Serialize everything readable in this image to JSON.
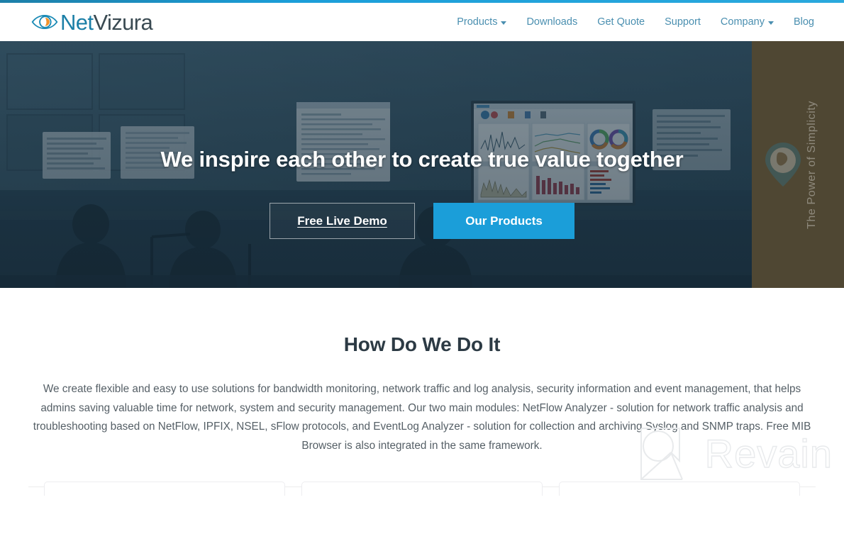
{
  "brand": {
    "name_part1": "Net",
    "name_part2": "Vizura",
    "logo_icon": "eye-icon",
    "accent_blue": "#1b9ed9",
    "logo_teal": "#1b7fa7",
    "logo_orange": "#f0922b"
  },
  "nav": {
    "items": [
      {
        "label": "Products",
        "has_dropdown": true
      },
      {
        "label": "Downloads",
        "has_dropdown": false
      },
      {
        "label": "Get Quote",
        "has_dropdown": false
      },
      {
        "label": "Support",
        "has_dropdown": false
      },
      {
        "label": "Company",
        "has_dropdown": true
      },
      {
        "label": "Blog",
        "has_dropdown": false
      }
    ]
  },
  "hero": {
    "title": "We inspire each other to create true value together",
    "primary_button": "Our Products",
    "secondary_button": "Free Live Demo",
    "side_panel_text": "The Power of Simplicity",
    "side_panel_color": "#4f4733",
    "side_panel_icon": "map-pin-globe-icon"
  },
  "main": {
    "section_title": "How Do We Do It",
    "section_body": "We create flexible and easy to use solutions for bandwidth monitoring, network traffic and log analysis, security information and event management, that helps admins saving valuable time for network, system and security management. Our two main modules: NetFlow Analyzer - solution for network traffic analysis and troubleshooting based on NetFlow, IPFIX, NSEL, sFlow protocols, and EventLog Analyzer - solution for collection and archiving Syslog and SNMP traps. Free MIB Browser is also integrated in the same framework."
  },
  "watermark": {
    "text": "Revain",
    "mark": "revain-logo-icon"
  }
}
